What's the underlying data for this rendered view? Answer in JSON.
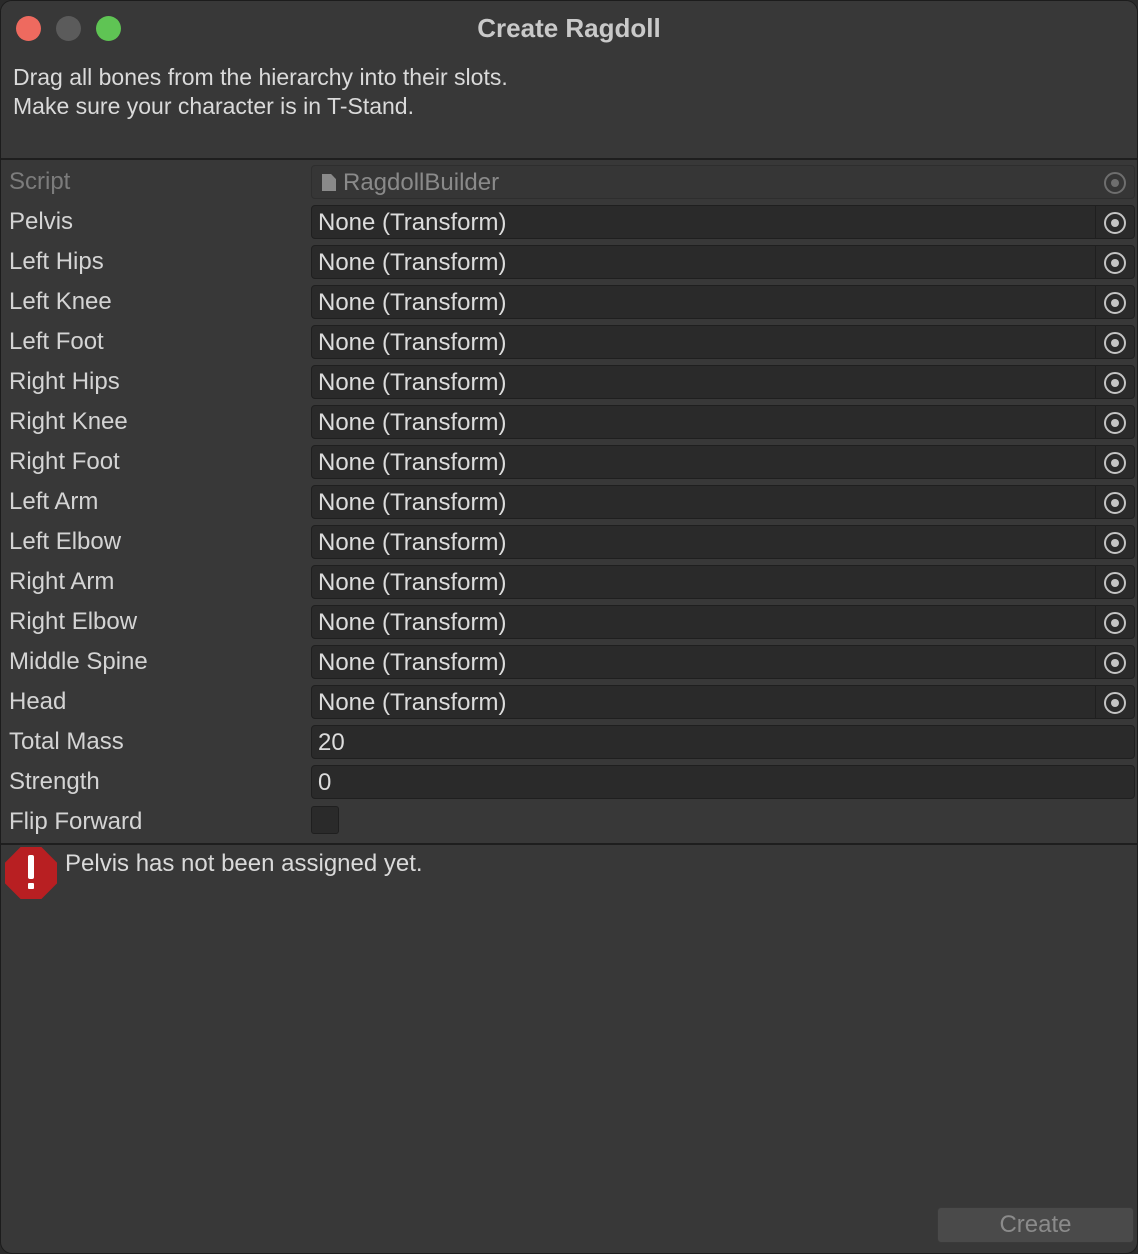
{
  "window": {
    "title": "Create Ragdoll"
  },
  "instructions": {
    "line1": "Drag all bones from the hierarchy into their slots.",
    "line2": "Make sure your character is in T-Stand."
  },
  "script_field": {
    "label": "Script",
    "value": "RagdollBuilder",
    "icon": "document-icon"
  },
  "bones": [
    {
      "label": "Pelvis",
      "value": "None (Transform)"
    },
    {
      "label": "Left Hips",
      "value": "None (Transform)"
    },
    {
      "label": "Left Knee",
      "value": "None (Transform)"
    },
    {
      "label": "Left Foot",
      "value": "None (Transform)"
    },
    {
      "label": "Right Hips",
      "value": "None (Transform)"
    },
    {
      "label": "Right Knee",
      "value": "None (Transform)"
    },
    {
      "label": "Right Foot",
      "value": "None (Transform)"
    },
    {
      "label": "Left Arm",
      "value": "None (Transform)"
    },
    {
      "label": "Left Elbow",
      "value": "None (Transform)"
    },
    {
      "label": "Right Arm",
      "value": "None (Transform)"
    },
    {
      "label": "Right Elbow",
      "value": "None (Transform)"
    },
    {
      "label": "Middle Spine",
      "value": "None (Transform)"
    },
    {
      "label": "Head",
      "value": "None (Transform)"
    }
  ],
  "total_mass": {
    "label": "Total Mass",
    "value": "20"
  },
  "strength": {
    "label": "Strength",
    "value": "0"
  },
  "flip_forward": {
    "label": "Flip Forward",
    "checked": false
  },
  "error": {
    "message": "Pelvis has not been assigned yet.",
    "icon": "error-icon",
    "color": "#b81f22"
  },
  "buttons": {
    "create_label": "Create"
  },
  "colors": {
    "window_bg": "#383838",
    "field_bg": "#2a2a2a",
    "close": "#ee6a5f",
    "maximize": "#5fc454"
  }
}
